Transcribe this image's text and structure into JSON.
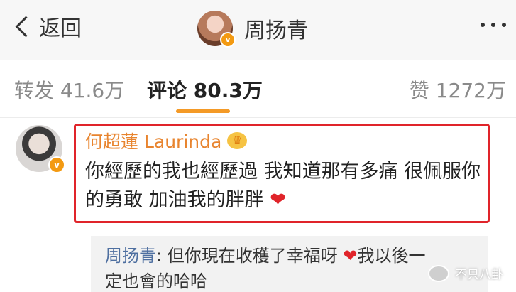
{
  "header": {
    "back_label": "返回",
    "title": "周扬青",
    "verified_badge": "v"
  },
  "tabs": {
    "repost": "转发 41.6万",
    "comment": "评论 80.3万",
    "like": "赞 1272万"
  },
  "comment": {
    "author": "何超蓮 Laurinda",
    "crown_icon": "crown-icon",
    "text": "你經歷的我也經歷過 我知道那有多痛 很佩服你的勇敢 加油我的胖胖",
    "heart": "❤",
    "highlight_color": "#e0242a"
  },
  "reply": {
    "name": "周扬青",
    "line1": ": 但你現在收穫了幸福呀",
    "heart": "❤",
    "line1_after": "我以後一",
    "line2": "定也會的哈哈"
  },
  "watermark": {
    "text": "不只八卦"
  },
  "colors": {
    "accent": "#f49a27",
    "author": "#e8842e",
    "reply_name": "#4e6fa0"
  }
}
